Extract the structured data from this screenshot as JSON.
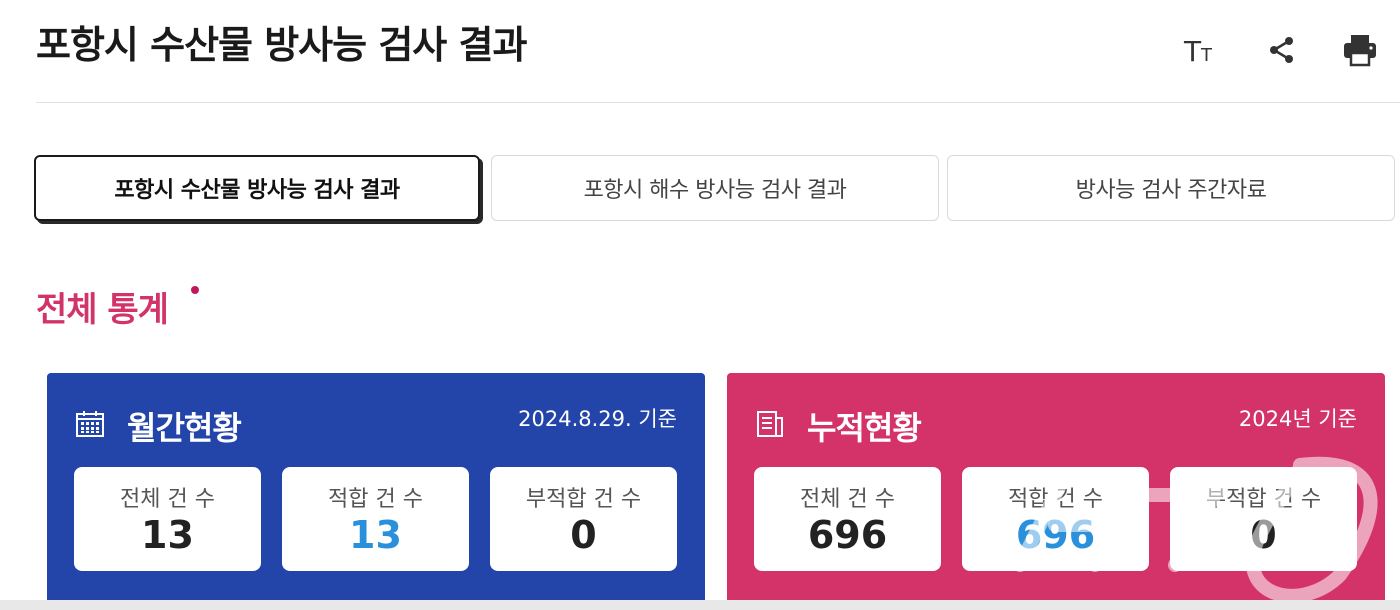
{
  "page": {
    "title": "포항시 수산물 방사능 검사 결과"
  },
  "toolbar": {
    "font_size_label": "Tт",
    "icons": [
      "font-size-icon",
      "share-icon",
      "print-icon"
    ]
  },
  "tabs": [
    {
      "label": "포항시 수산물 방사능 검사 결과",
      "active": true
    },
    {
      "label": "포항시 해수 방사능 검사 결과",
      "active": false
    },
    {
      "label": "방사능 검사 주간자료",
      "active": false
    }
  ],
  "section": {
    "title": "전체 통계"
  },
  "monthly": {
    "title": "월간현황",
    "date": "2024.8.29. 기준",
    "icon": "calendar-icon",
    "color": "#2344a8",
    "cards": [
      {
        "label": "전체 건 수",
        "value": "13"
      },
      {
        "label": "적합 건 수",
        "value": "13"
      },
      {
        "label": "부적합 건 수",
        "value": "0"
      }
    ]
  },
  "cumulative": {
    "title": "누적현황",
    "date": "2024년 기준",
    "icon": "document-list-icon",
    "color": "#d4336a",
    "cards": [
      {
        "label": "전체 건 수",
        "value": "696"
      },
      {
        "label": "적합 건 수",
        "value": "696"
      },
      {
        "label": "부적합 건 수",
        "value": "0"
      }
    ]
  },
  "colors": {
    "accent_pink": "#d2346a",
    "pass_blue": "#2b90dc"
  },
  "watermark": {
    "icon": "news1-watermark-icon"
  }
}
